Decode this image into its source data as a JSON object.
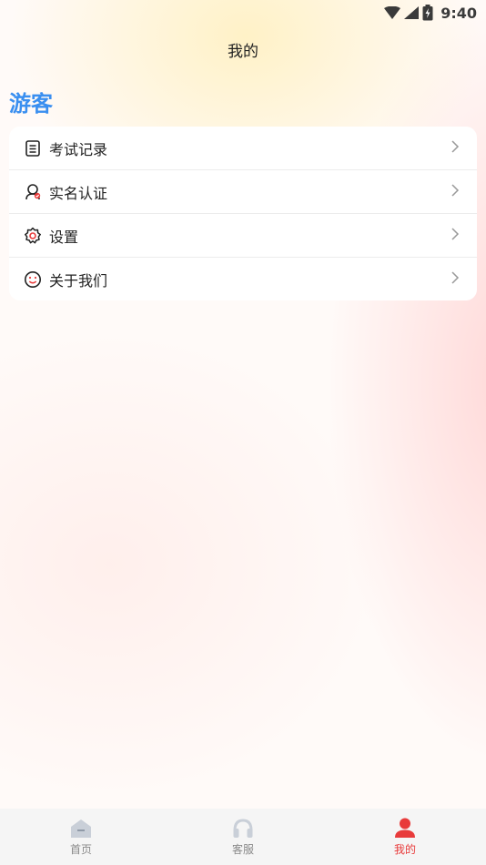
{
  "status_bar": {
    "time": "9:40",
    "icons": [
      "wifi-icon",
      "signal-icon",
      "battery-icon"
    ]
  },
  "header": {
    "title": "我的"
  },
  "profile": {
    "username": "游客",
    "color": "#3a8ff0"
  },
  "menu": {
    "items": [
      {
        "label": "考试记录",
        "icon": "exam-record-icon"
      },
      {
        "label": "实名认证",
        "icon": "real-name-auth-icon"
      },
      {
        "label": "设置",
        "icon": "settings-icon"
      },
      {
        "label": "关于我们",
        "icon": "about-us-icon"
      }
    ]
  },
  "tabbar": {
    "active_color": "#e83b3b",
    "tabs": [
      {
        "label": "首页",
        "icon": "home-icon",
        "active": false
      },
      {
        "label": "客服",
        "icon": "headset-icon",
        "active": false
      },
      {
        "label": "我的",
        "icon": "user-icon",
        "active": true
      }
    ]
  }
}
